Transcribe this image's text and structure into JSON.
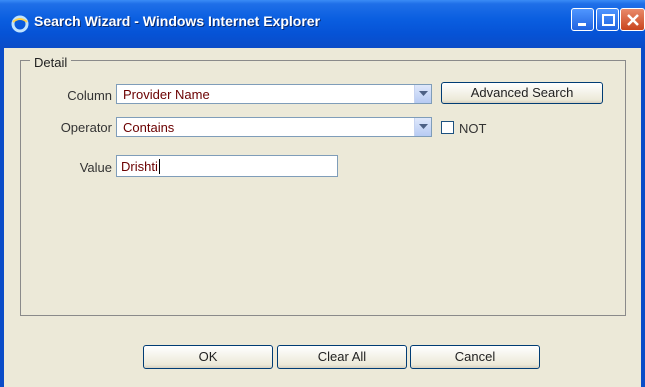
{
  "window": {
    "title": "Search Wizard - Windows Internet Explorer"
  },
  "detail": {
    "legend": "Detail",
    "column": {
      "label": "Column",
      "selected": "Provider Name"
    },
    "advanced_search_label": "Advanced Search",
    "operator": {
      "label": "Operator",
      "selected": "Contains"
    },
    "not_label": "NOT",
    "not_checked": false,
    "value": {
      "label": "Value",
      "text": "Drishti"
    }
  },
  "footer": {
    "ok_label": "OK",
    "clear_all_label": "Clear All",
    "cancel_label": "Cancel"
  },
  "colors": {
    "titlebar": "#0a5ee0",
    "field_text": "#6b0000",
    "face": "#ece9d8"
  }
}
